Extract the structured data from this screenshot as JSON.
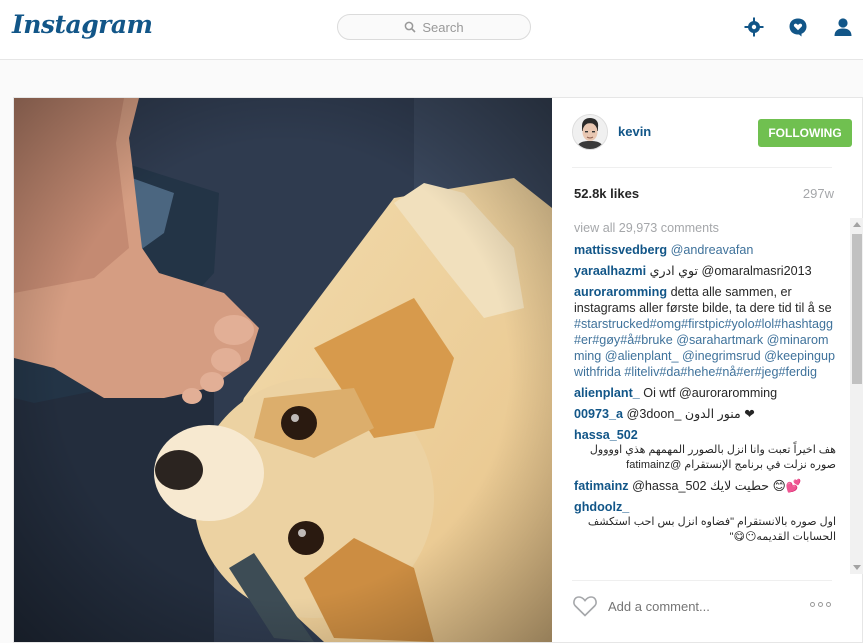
{
  "nav": {
    "logo": "Instagram",
    "search_placeholder": "Search",
    "icons": [
      "explore-icon",
      "activity-icon",
      "profile-icon"
    ]
  },
  "post": {
    "username": "kevin",
    "follow_label": "FOLLOWING",
    "likes": "52.8k likes",
    "age": "297w",
    "view_all": "view all 29,973 comments",
    "add_comment_placeholder": "Add a comment...",
    "comments": [
      {
        "user": "mattissvedberg",
        "text": "@andreavafan"
      },
      {
        "user": "yaraalhazmi",
        "text": "توي ادري @omaralmasri2013"
      },
      {
        "user": "auroraromming",
        "text": "detta alle sammen, er instagrams aller første bilde, ta dere tid til å se",
        "tags": "#starstrucked#omg#firstpic#yolo#lol#hashtagg#er#gøy#å#bruke @sarahartmark @minaromming @alienplant_ @inegrimsrud @keepingupwithfrida #liteliv#da#hehe#nå#er#jeg#ferdig"
      },
      {
        "user": "alienplant_",
        "text": "Oi wtf @auroraromming"
      },
      {
        "user": "00973_a",
        "text": "@3doon_ منور الدون ❤"
      },
      {
        "user": "hassa_502",
        "text": "هف اخيراً تعبت وانا انزل بالصورر  المهمهم هذي اوووول صوره نزلت في برنامج الإنستقرام  @fatimainz"
      },
      {
        "user": "fatimainz",
        "text": "@hassa_502 حطيت لايك 😊💕"
      },
      {
        "user": "ghdoolz_",
        "text": "اول صوره بالانستقرام \"فضاوه انزل  بس احب استكشف الحسابات القديمه😶😋\""
      }
    ]
  },
  "colors": {
    "brand": "#125688",
    "following_button": "#70c050",
    "link": "#3f729b",
    "muted": "#a5a7aa"
  }
}
